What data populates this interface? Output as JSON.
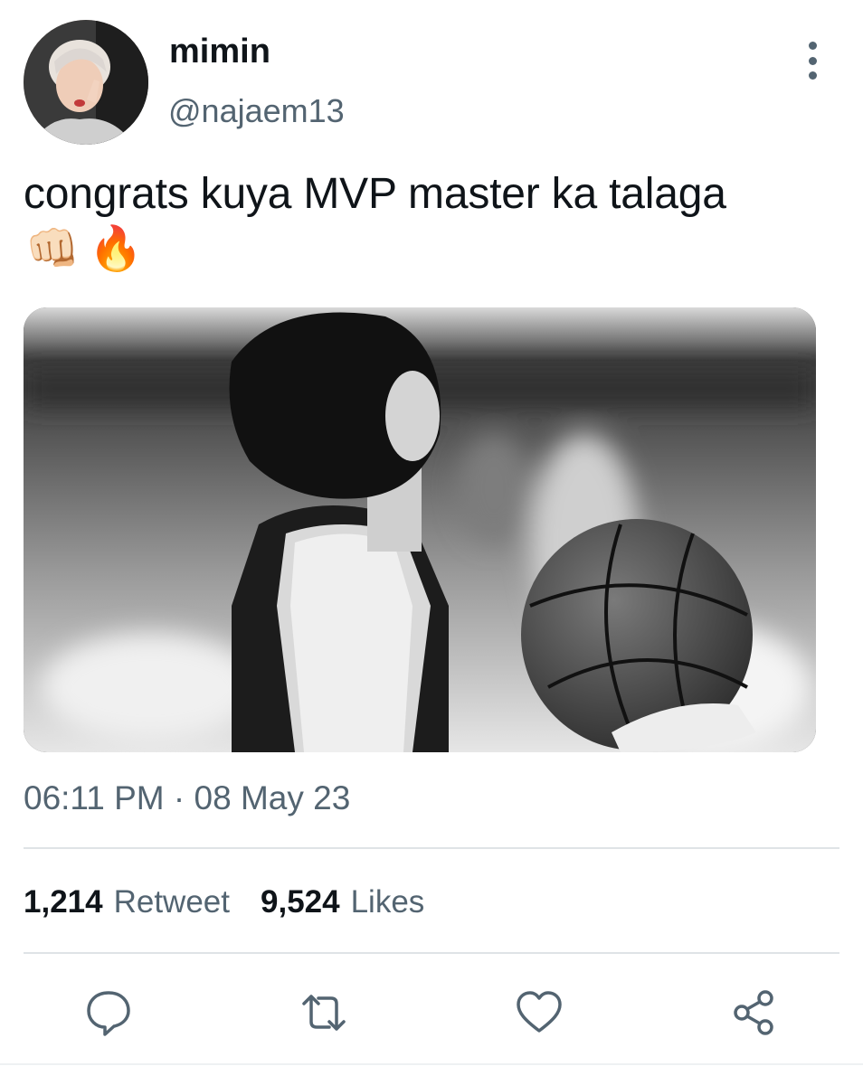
{
  "author": {
    "display_name": "mimin",
    "handle": "@najaem13"
  },
  "tweet": {
    "text": "congrats kuya MVP master ka talaga",
    "emojis": [
      "👊🏻",
      "🔥"
    ],
    "timestamp": "06:11 PM · 08 May 23"
  },
  "stats": {
    "retweets_count": "1,214",
    "retweets_label": "Retweet",
    "likes_count": "9,524",
    "likes_label": "Likes"
  },
  "icons": {
    "more": "more-vertical-icon",
    "reply": "reply-bubble-icon",
    "retweet": "retweet-arrows-icon",
    "like": "heart-icon",
    "share": "share-nodes-icon"
  },
  "colors": {
    "primary_text": "#0f1419",
    "secondary_text": "#536471",
    "divider": "#dfe3e6"
  }
}
